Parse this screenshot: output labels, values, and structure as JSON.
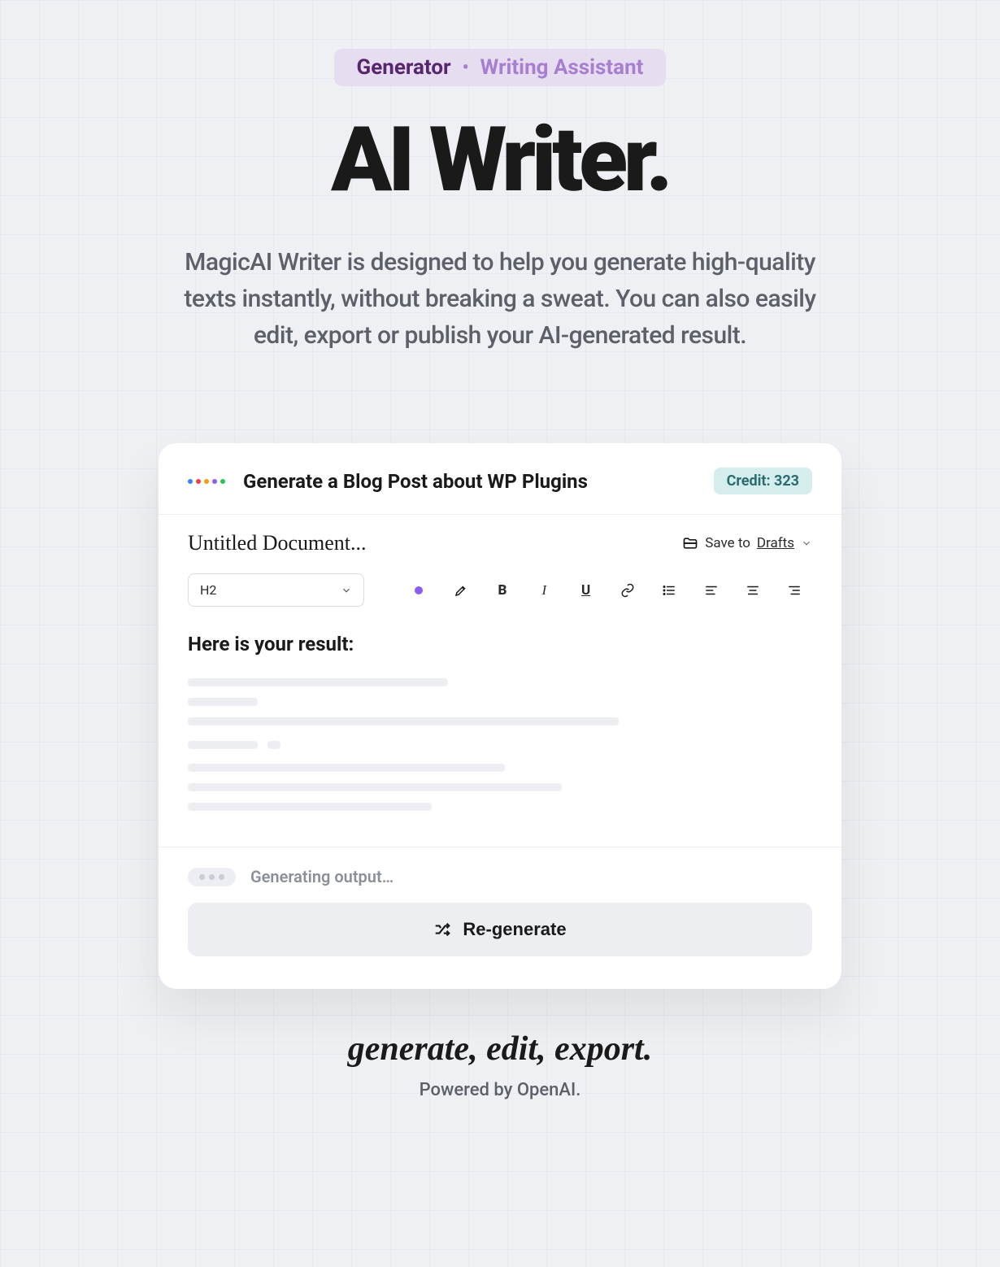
{
  "pill": {
    "active": "Generator",
    "secondary": "Writing Assistant"
  },
  "title": "AI Writer.",
  "subtitle": "MagicAI Writer is designed to help you generate high-quality texts instantly, without breaking a sweat. You can also easily edit, export or publish your AI-generated result.",
  "card": {
    "prompt": "Generate a Blog Post about WP Plugins",
    "credit_label": "Credit: 323",
    "doc_title": "Untitled Document...",
    "save_prefix": "Save to",
    "save_target": "Drafts",
    "heading_select": "H2",
    "result_heading": "Here is your result:",
    "generating": "Generating output…",
    "regenerate": "Re-generate"
  },
  "tagline": "generate, edit, export.",
  "powered": "Powered by OpenAI."
}
